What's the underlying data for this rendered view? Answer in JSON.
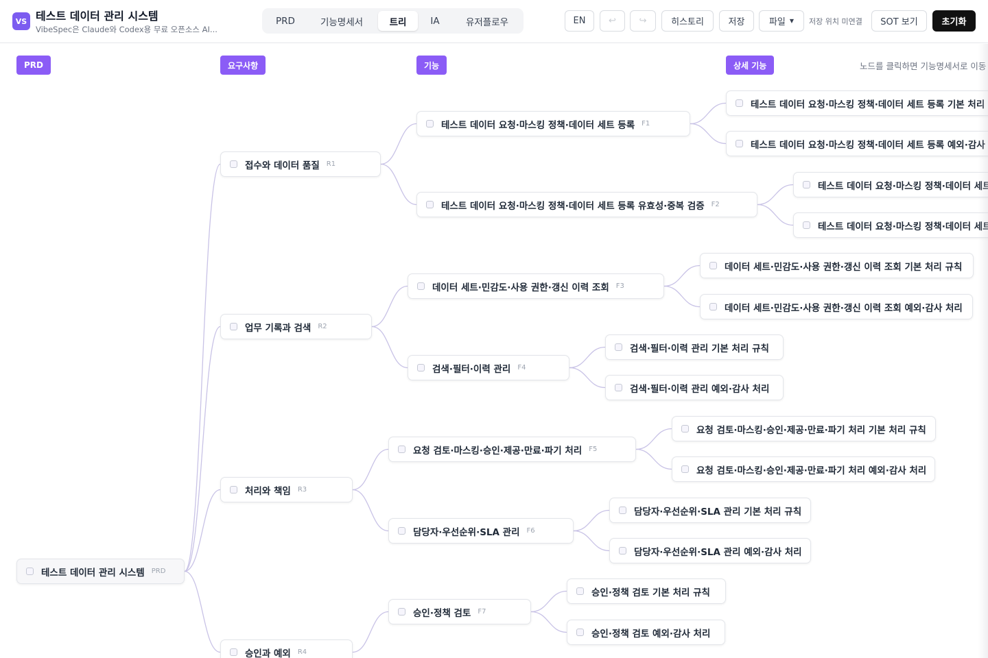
{
  "header": {
    "logo": "VS",
    "title": "테스트 데이터 관리 시스템",
    "subtitle": "VibeSpec은 Claude와 Codex용 무료 오픈소스 AI..."
  },
  "tabs": [
    {
      "label": "PRD"
    },
    {
      "label": "기능명세서"
    },
    {
      "label": "트리",
      "active": true
    },
    {
      "label": "IA"
    },
    {
      "label": "유저플로우"
    }
  ],
  "toolbar": {
    "lang": "EN",
    "undo_icon": "↩",
    "redo_icon": "↪",
    "history": "히스토리",
    "save": "저장",
    "file": "파일",
    "save_location": "저장 위치 미연결",
    "sot": "SOT 보기",
    "reset": "초기화"
  },
  "columns": [
    "PRD",
    "요구사항",
    "기능",
    "상세 기능"
  ],
  "hint": "노드를 클릭하면 기능명세서로 이동",
  "tree": {
    "root": {
      "label": "테스트 데이터 관리 시스템",
      "code": "PRD"
    },
    "requirements": [
      {
        "label": "접수와 데이터 품질",
        "code": "R1"
      },
      {
        "label": "업무 기록과 검색",
        "code": "R2"
      },
      {
        "label": "처리와 책임",
        "code": "R3"
      },
      {
        "label": "승인과 예외",
        "code": "R4"
      }
    ],
    "features": [
      {
        "label": "테스트 데이터 요청·마스킹 정책·데이터 세트 등록",
        "code": "F1"
      },
      {
        "label": "테스트 데이터 요청·마스킹 정책·데이터 세트 등록 유효성·중복 검증",
        "code": "F2"
      },
      {
        "label": "데이터 세트·민감도·사용 권한·갱신 이력 조회",
        "code": "F3"
      },
      {
        "label": "검색·필터·이력 관리",
        "code": "F4"
      },
      {
        "label": "요청 검토·마스킹·승인·제공·만료·파기 처리",
        "code": "F5"
      },
      {
        "label": "담당자·우선순위·SLA 관리",
        "code": "F6"
      },
      {
        "label": "승인·정책 검토",
        "code": "F7"
      }
    ],
    "details": [
      {
        "label": "테스트 데이터 요청·마스킹 정책·데이터 세트 등록 기본 처리 규칙"
      },
      {
        "label": "테스트 데이터 요청·마스킹 정책·데이터 세트 등록 예외·감사 처리"
      },
      {
        "label": "테스트 데이터 요청·마스킹 정책·데이터 세트 등록 유효성·중복 검증 기본 처리 규칙"
      },
      {
        "label": "테스트 데이터 요청·마스킹 정책·데이터 세트 등록 유효성·중복 검증 예외·감사 처리"
      },
      {
        "label": "데이터 세트·민감도·사용 권한·갱신 이력 조회 기본 처리 규칙"
      },
      {
        "label": "데이터 세트·민감도·사용 권한·갱신 이력 조회 예외·감사 처리"
      },
      {
        "label": "검색·필터·이력 관리 기본 처리 규칙"
      },
      {
        "label": "검색·필터·이력 관리 예외·감사 처리"
      },
      {
        "label": "요청 검토·마스킹·승인·제공·만료·파기 처리 기본 처리 규칙"
      },
      {
        "label": "요청 검토·마스킹·승인·제공·만료·파기 처리 예외·감사 처리"
      },
      {
        "label": "담당자·우선순위·SLA 관리 기본 처리 규칙"
      },
      {
        "label": "담당자·우선순위·SLA 관리 예외·감사 처리"
      },
      {
        "label": "승인·정책 검토 기본 처리 규칙"
      },
      {
        "label": "승인·정책 검토 예외·감사 처리"
      }
    ]
  }
}
